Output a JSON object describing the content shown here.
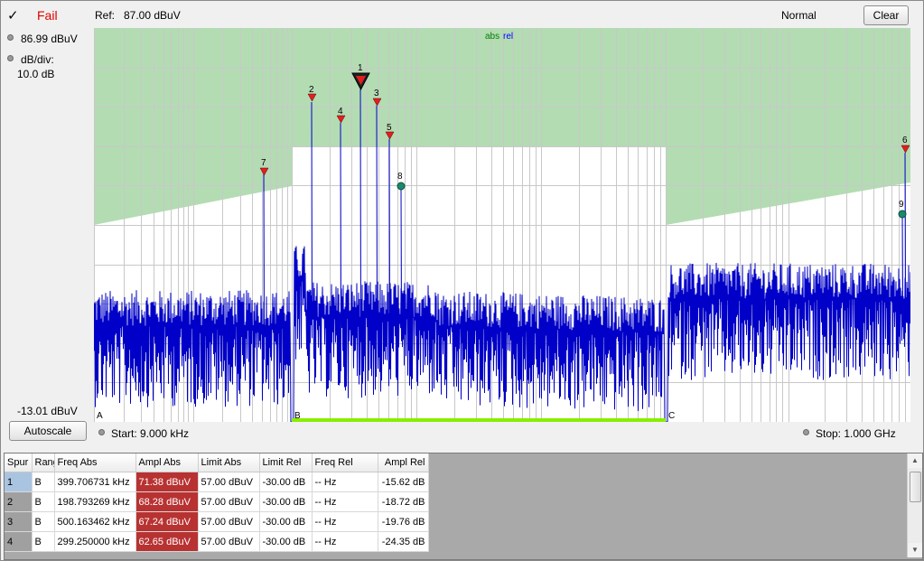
{
  "status": {
    "check": "✓",
    "label": "Fail"
  },
  "ref": {
    "label": "Ref:",
    "value": "87.00 dBuV"
  },
  "mode": "Normal",
  "buttons": {
    "clear": "Clear",
    "autoscale": "Autoscale"
  },
  "left_panel": {
    "marker_value": "86.99 dBuV",
    "dbdiv_label": "dB/div:",
    "dbdiv_value": "10.0 dB",
    "bottom_value": "-13.01 dBuV"
  },
  "footer": {
    "start": "Start: 9.000 kHz",
    "stop": "Stop: 1.000 GHz"
  },
  "plot": {
    "legend_abs": "abs",
    "legend_rel": "rel",
    "range_labels": [
      "A",
      "B",
      "C"
    ],
    "markers": [
      {
        "id": "1",
        "type": "triangle-large"
      },
      {
        "id": "2",
        "type": "triangle"
      },
      {
        "id": "3",
        "type": "triangle"
      },
      {
        "id": "4",
        "type": "triangle"
      },
      {
        "id": "5",
        "type": "triangle"
      },
      {
        "id": "6",
        "type": "triangle"
      },
      {
        "id": "7",
        "type": "triangle"
      },
      {
        "id": "8",
        "type": "circle"
      },
      {
        "id": "9",
        "type": "circle"
      }
    ],
    "colors": {
      "limit_fill": "#b3dcb3",
      "trace": "#0000c8",
      "marker": "#e02020",
      "circle_marker": "#1a8a6e",
      "range_bar": "#88ee00"
    }
  },
  "table": {
    "columns": [
      "Spur",
      "Range",
      "Freq Abs",
      "Ampl Abs",
      "Limit Abs",
      "Limit Rel",
      "Freq Rel",
      "Ampl Rel"
    ],
    "rows": [
      [
        "1",
        "B",
        "399.706731 kHz",
        "71.38 dBuV",
        "57.00 dBuV",
        "-30.00 dB",
        "-- Hz",
        "-15.62 dB"
      ],
      [
        "2",
        "B",
        "198.793269 kHz",
        "68.28 dBuV",
        "57.00 dBuV",
        "-30.00 dB",
        "-- Hz",
        "-18.72 dB"
      ],
      [
        "3",
        "B",
        "500.163462 kHz",
        "67.24 dBuV",
        "57.00 dBuV",
        "-30.00 dB",
        "-- Hz",
        "-19.76 dB"
      ],
      [
        "4",
        "B",
        "299.250000 kHz",
        "62.65 dBuV",
        "57.00 dBuV",
        "-30.00 dB",
        "-- Hz",
        "-24.35 dB"
      ]
    ]
  }
}
